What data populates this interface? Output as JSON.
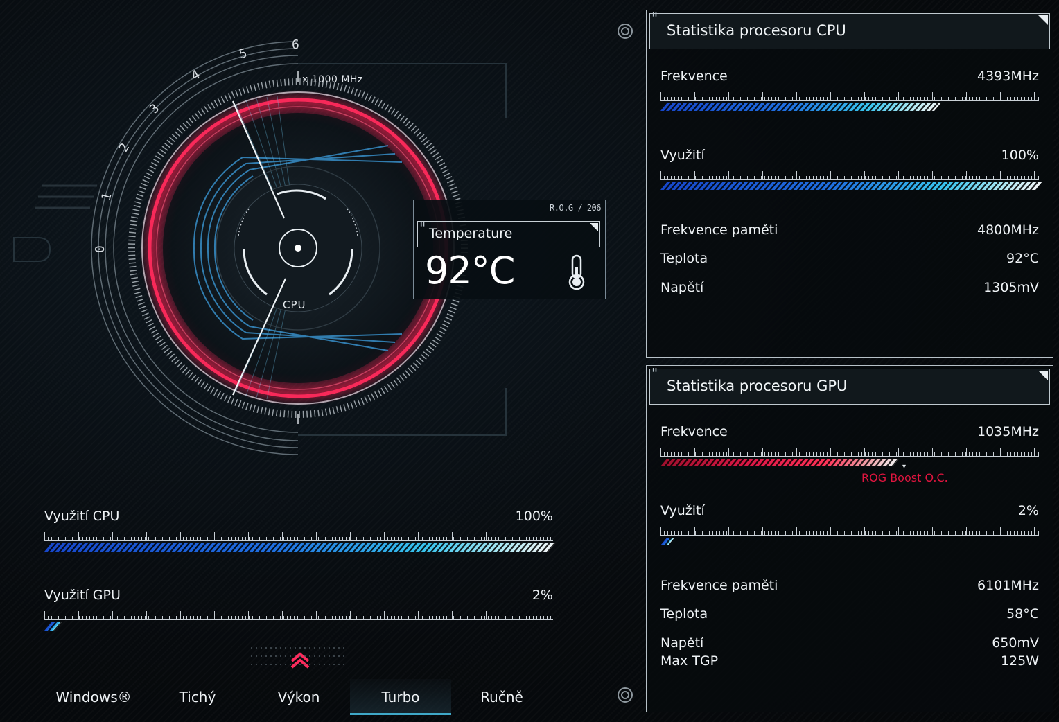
{
  "gauge": {
    "scale_labels": [
      "0",
      "1",
      "2",
      "3",
      "4",
      "5",
      "6"
    ],
    "unit_label": "x 1000 MHz",
    "center_label": "CPU"
  },
  "temperature_card": {
    "brand": "R.O.G / 206",
    "label": "Temperature",
    "value": "92°C",
    "icon": "thermometer-icon"
  },
  "usage": {
    "cpu": {
      "label": "Využití CPU",
      "value": "100%",
      "level": 1.0
    },
    "gpu": {
      "label": "Využití GPU",
      "value": "2%",
      "level": 0.02
    }
  },
  "modes": {
    "items": [
      "Windows®",
      "Tichý",
      "Výkon",
      "Turbo",
      "Ručně"
    ],
    "active": "Turbo"
  },
  "cpu_panel": {
    "title": "Statistika procesoru CPU",
    "frequency": {
      "label": "Frekvence",
      "value": "4393MHz",
      "level": 0.73
    },
    "utilization": {
      "label": "Využití",
      "value": "100%",
      "level": 1.0
    },
    "mem_freq": {
      "label": "Frekvence paměti",
      "value": "4800MHz"
    },
    "temperature": {
      "label": "Teplota",
      "value": "92°C"
    },
    "voltage": {
      "label": "Napětí",
      "value": "1305mV"
    }
  },
  "gpu_panel": {
    "title": "Statistika procesoru GPU",
    "frequency": {
      "label": "Frekvence",
      "value": "1035MHz",
      "level": 0.62
    },
    "boost_label": "ROG Boost O.C.",
    "utilization": {
      "label": "Využití",
      "value": "2%",
      "level": 0.02
    },
    "mem_freq": {
      "label": "Frekvence paměti",
      "value": "6101MHz"
    },
    "temperature": {
      "label": "Teplota",
      "value": "58°C"
    },
    "voltage": {
      "label": "Napětí",
      "value": "650mV"
    },
    "max_tgp": {
      "label": "Max TGP",
      "value": "125W"
    }
  },
  "colors": {
    "accent_red": "#e0153f",
    "accent_blue": "#1f6fe0",
    "accent_cyan": "#38c4ee"
  }
}
